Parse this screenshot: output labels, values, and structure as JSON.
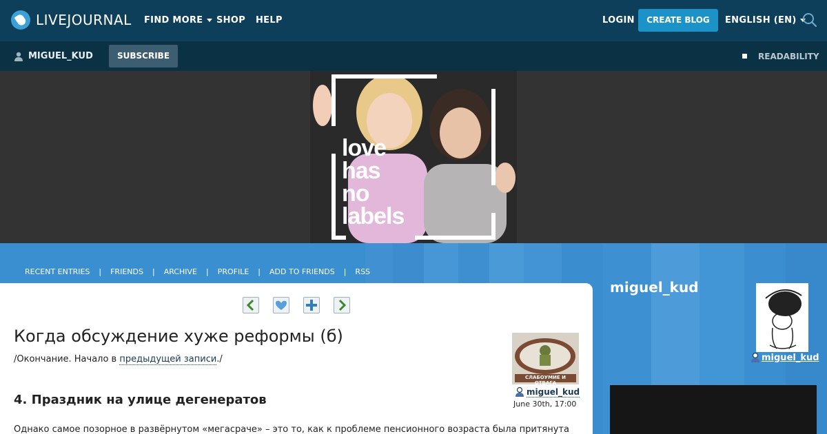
{
  "topbar": {
    "brand": "LIVEJOURNAL",
    "nav": [
      "FIND MORE",
      "SHOP",
      "HELP"
    ],
    "login": "LOGIN",
    "create_blog": "CREATE BLOG",
    "language": "ENGLISH (EN)"
  },
  "subbar": {
    "username": "MIGUEL_KUD",
    "subscribe": "SUBSCRIBE",
    "readability": "READABILITY"
  },
  "banner": {
    "text_lines": [
      "love",
      "has",
      "no",
      "labels"
    ]
  },
  "journal_nav": [
    "RECENT ENTRIES",
    "FRIENDS",
    "ARCHIVE",
    "PROFILE",
    "ADD TO FRIENDS",
    "RSS"
  ],
  "post": {
    "title": "Когда обсуждение хуже реформы (б)",
    "intro_before": "/Окончание. Начало в ",
    "intro_link": "предыдущей записи",
    "intro_after": "./",
    "heading": "4. Праздник на улице дегенератов",
    "body": "Однако самое позорное в развёрнутом «мегасраче» – это то, как к проблеме пенсионного возраста была притянута",
    "author": "miguel_kud",
    "date": "June 30th, 17:00",
    "userpic_caption": "СЛАБОУМИЕ И ОТВАГА"
  },
  "sidebar": {
    "name": "miguel_kud",
    "user_link": "miguel_kud"
  }
}
